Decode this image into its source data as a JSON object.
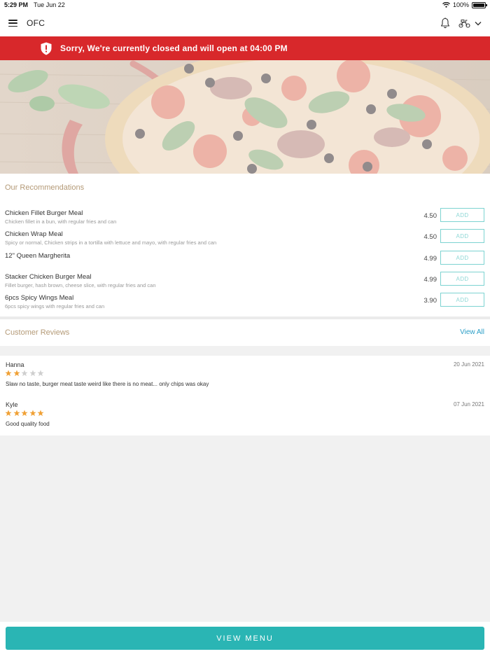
{
  "status_bar": {
    "time": "5:29 PM",
    "date": "Tue Jun 22",
    "battery": "100%"
  },
  "header": {
    "title": "OFC",
    "icons": [
      "menu-icon",
      "bell-icon",
      "delivery-scooter-icon",
      "chevron-down-icon"
    ]
  },
  "banner": {
    "message": "Sorry, We're currently closed and will open at 04:00 PM",
    "icon": "shield-alert-icon",
    "color": "#d8282b"
  },
  "recommendations": {
    "title": "Our Recommendations",
    "add_label": "ADD",
    "items": [
      {
        "name": "Chicken Fillet Burger Meal",
        "description": "Chicken fillet in a bun, with regular fries and can",
        "price": "4.50"
      },
      {
        "name": "Chicken Wrap Meal",
        "description": "Spicy or normal, Chicken strips in a tortilla with lettuce and mayo, with regular fries and can",
        "price": "4.50"
      },
      {
        "name": "12\" Queen Margherita",
        "description": "",
        "price": "4.99"
      },
      {
        "name": "Stacker Chicken Burger Meal",
        "description": "Fillet burger, hash brown, cheese slice, with regular fries and can",
        "price": "4.99"
      },
      {
        "name": "6pcs Spicy Wings Meal",
        "description": "6pcs spicy wings with regular fries and can",
        "price": "3.90"
      }
    ]
  },
  "reviews": {
    "title": "Customer Reviews",
    "view_all": "View All",
    "items": [
      {
        "name": "Hanna",
        "date": "20 Jun 2021",
        "rating": 2,
        "text": "Slaw no taste, burger meat  taste weird like there is no meat... only chips was okay"
      },
      {
        "name": "Kyle",
        "date": "07 Jun 2021",
        "rating": 5,
        "text": "Good quality food"
      }
    ]
  },
  "footer": {
    "button_label": "VIEW MENU",
    "accent": "#2ab5b4"
  }
}
